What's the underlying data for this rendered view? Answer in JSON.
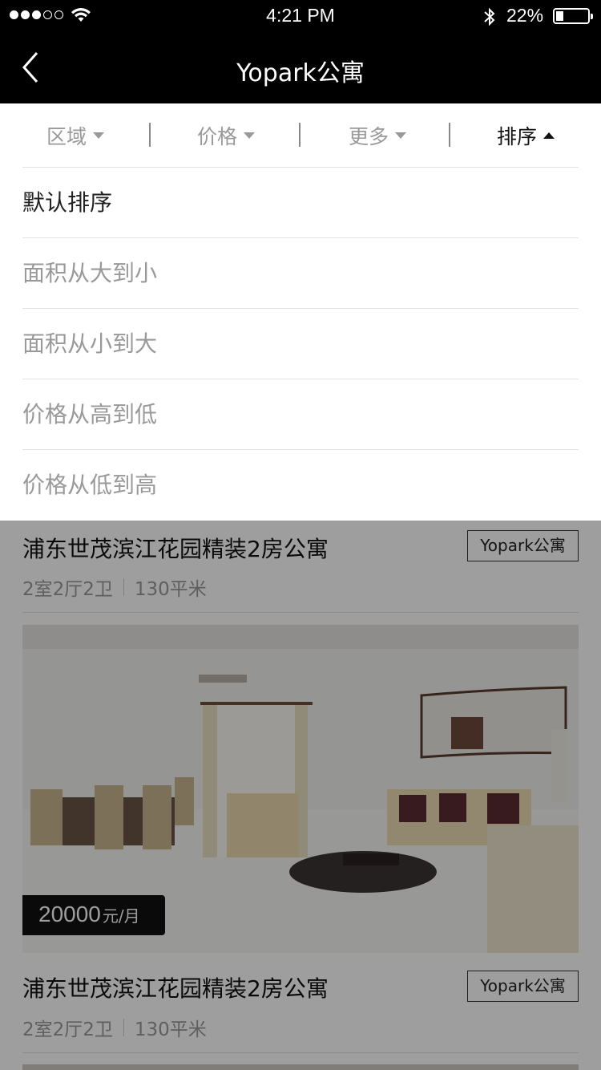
{
  "status_bar": {
    "time": "4:21 PM",
    "battery_percent": "22%",
    "battery_level": 0.22,
    "signal_dots_filled": 3,
    "signal_dots_total": 5,
    "icons": [
      "signal-dots-icon",
      "wifi-icon",
      "bluetooth-icon",
      "battery-icon"
    ]
  },
  "nav": {
    "title": "Yopark公寓",
    "back_icon": "chevron-left-icon"
  },
  "filters": {
    "items": [
      {
        "label": "区域",
        "state": "collapsed"
      },
      {
        "label": "价格",
        "state": "collapsed"
      },
      {
        "label": "更多",
        "state": "collapsed"
      },
      {
        "label": "排序",
        "state": "expanded"
      }
    ]
  },
  "sort_dropdown": {
    "options": [
      {
        "label": "默认排序",
        "selected": true
      },
      {
        "label": "面积从大到小",
        "selected": false
      },
      {
        "label": "面积从小到大",
        "selected": false
      },
      {
        "label": "价格从高到低",
        "selected": false
      },
      {
        "label": "价格从低到高",
        "selected": false
      }
    ]
  },
  "listings": [
    {
      "title": "浦东世茂滨江花园精装2房公寓",
      "tag": "Yopark公寓",
      "layout": "2室2厅2卫",
      "area": "130平米",
      "price": "20000",
      "price_unit": "元/月"
    },
    {
      "title": "浦东世茂滨江花园精装2房公寓",
      "tag": "Yopark公寓",
      "layout": "2室2厅2卫",
      "area": "130平米"
    }
  ],
  "colors": {
    "header_bg": "#000000",
    "active_text": "#111111",
    "inactive_text": "#999999",
    "divider": "#e2e2e2",
    "overlay": "rgba(0,0,0,0.38)"
  }
}
